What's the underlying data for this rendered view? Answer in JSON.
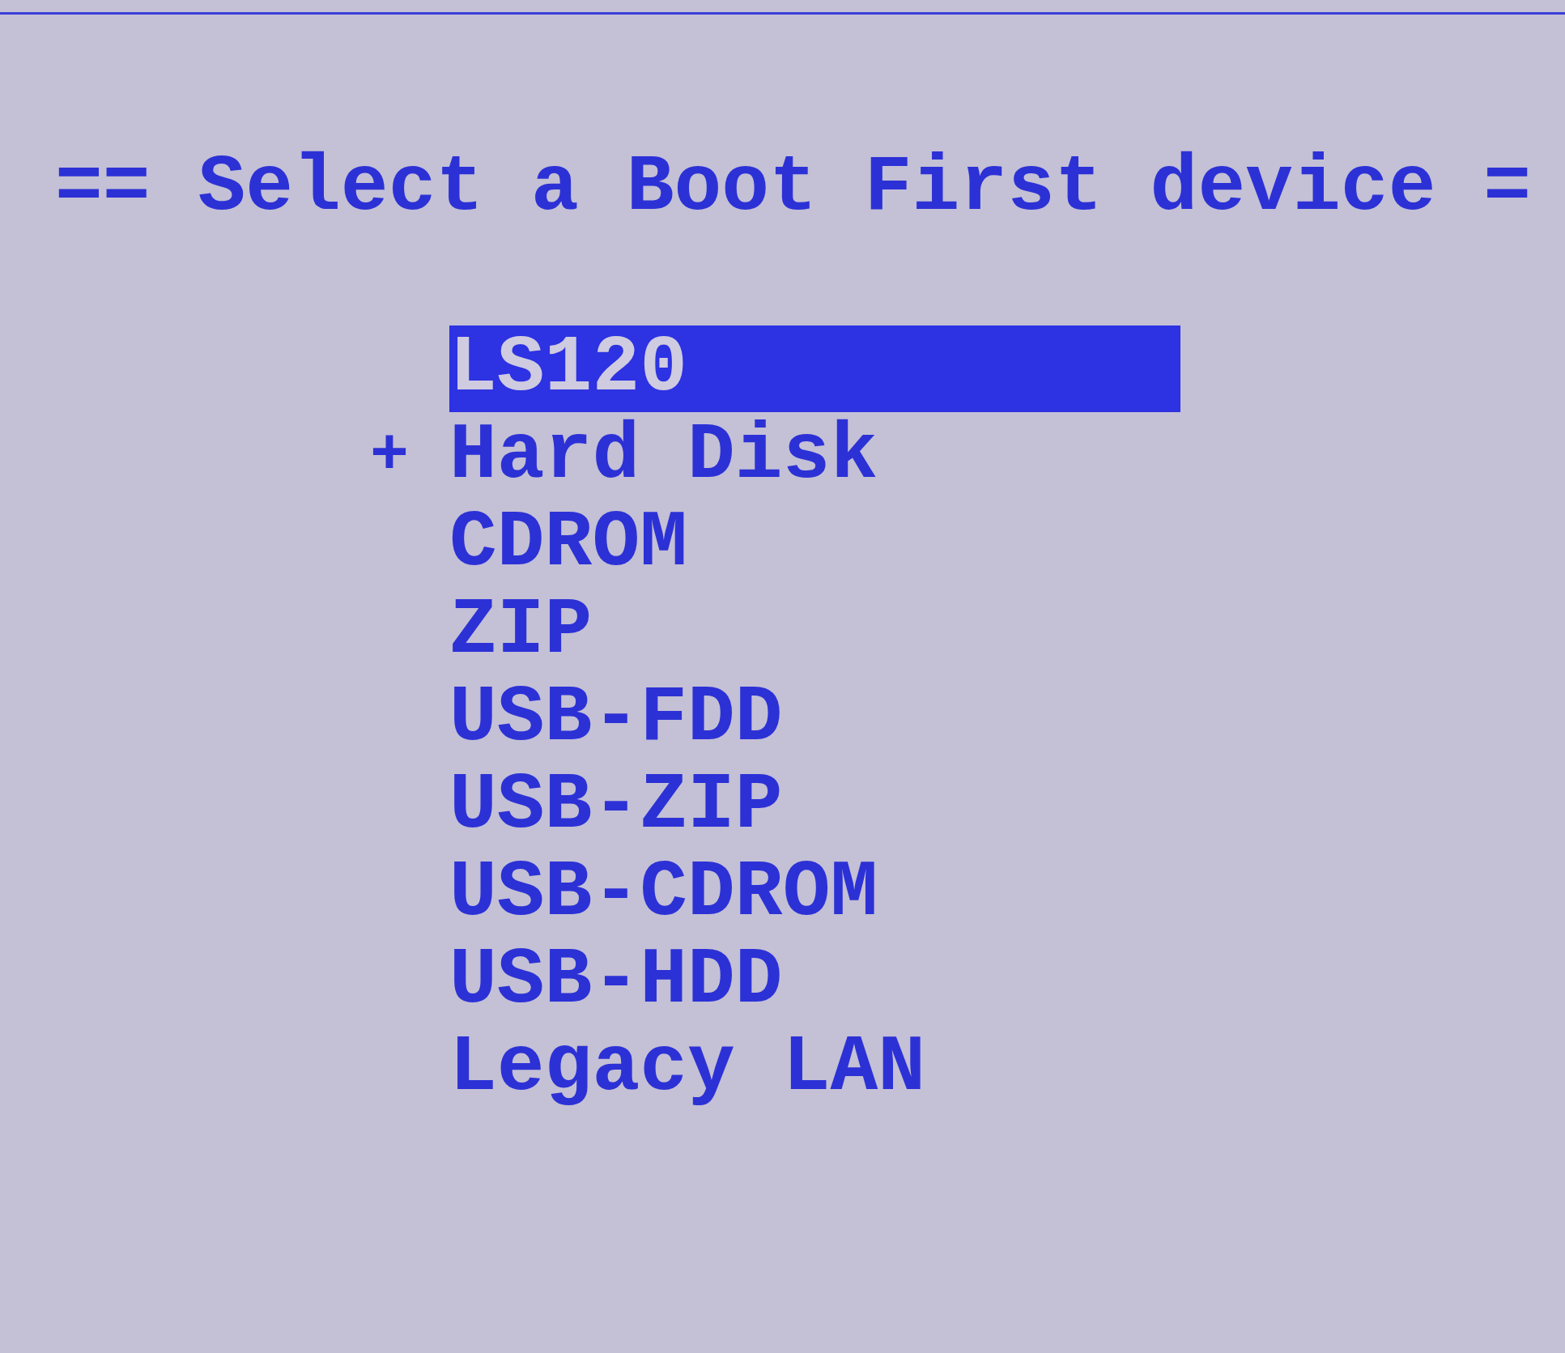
{
  "title": "== Select a Boot First device =",
  "devices": [
    {
      "label": "LS120",
      "selected": true
    },
    {
      "label": "Hard Disk",
      "selected": false,
      "marker": "+"
    },
    {
      "label": "CDROM",
      "selected": false
    },
    {
      "label": "ZIP",
      "selected": false
    },
    {
      "label": "USB-FDD",
      "selected": false
    },
    {
      "label": "USB-ZIP",
      "selected": false
    },
    {
      "label": "USB-CDROM",
      "selected": false
    },
    {
      "label": "USB-HDD",
      "selected": false
    },
    {
      "label": "Legacy LAN",
      "selected": false
    }
  ]
}
